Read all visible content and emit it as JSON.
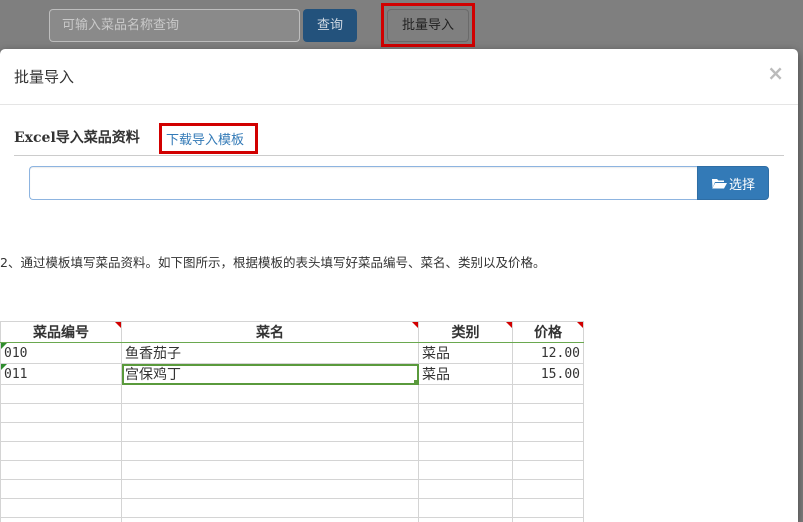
{
  "toolbar": {
    "search_placeholder": "可输入菜品名称查询",
    "query_label": "查询",
    "batch_import_label": "批量导入"
  },
  "modal": {
    "title": "批量导入",
    "close_symbol": "×",
    "section_title": "Excel导入菜品资料",
    "download_link": "下载导入模板",
    "choose_label": "选择",
    "instruction": "2、通过模板填写菜品资料。如下图所示，根据模板的表头填写好菜品编号、菜名、类别以及价格。"
  },
  "sheet": {
    "headers": [
      "菜品编号",
      "菜名",
      "类别",
      "价格"
    ],
    "rows": [
      [
        "010",
        "鱼香茄子",
        "菜品",
        "12.00"
      ],
      [
        "011",
        "宫保鸡丁",
        "菜品",
        "15.00"
      ]
    ]
  },
  "colors": {
    "primary": "#337ab7",
    "highlight": "#d10000",
    "selection": "#5a9a3c"
  }
}
